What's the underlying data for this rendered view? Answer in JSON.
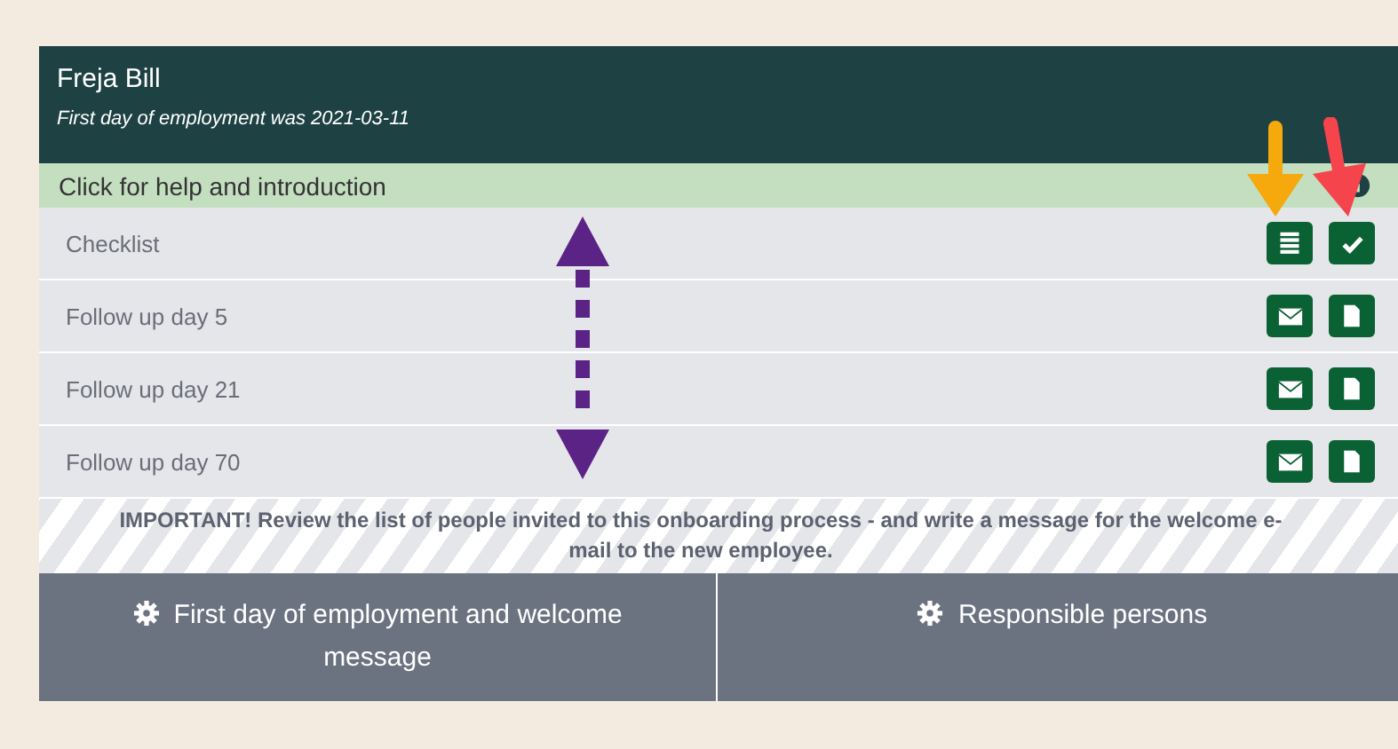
{
  "header": {
    "name": "Freja Bill",
    "subtitle": "First day of employment was 2021-03-11"
  },
  "help_bar": {
    "label": "Click for help and introduction"
  },
  "rows": [
    {
      "label": "Checklist",
      "actions": [
        {
          "kind": "list"
        },
        {
          "kind": "check"
        }
      ]
    },
    {
      "label": "Follow up day 5",
      "actions": [
        {
          "kind": "mail"
        },
        {
          "kind": "file"
        }
      ]
    },
    {
      "label": "Follow up day 21",
      "actions": [
        {
          "kind": "mail"
        },
        {
          "kind": "file"
        }
      ]
    },
    {
      "label": "Follow up day 70",
      "actions": [
        {
          "kind": "mail"
        },
        {
          "kind": "file"
        }
      ]
    }
  ],
  "notice": "IMPORTANT! Review the list of people invited to this onboarding process - and write a message for the welcome e-mail to the new employee.",
  "buttons": [
    {
      "label": "First day of employment and welcome message"
    },
    {
      "label": "Responsible persons"
    }
  ]
}
